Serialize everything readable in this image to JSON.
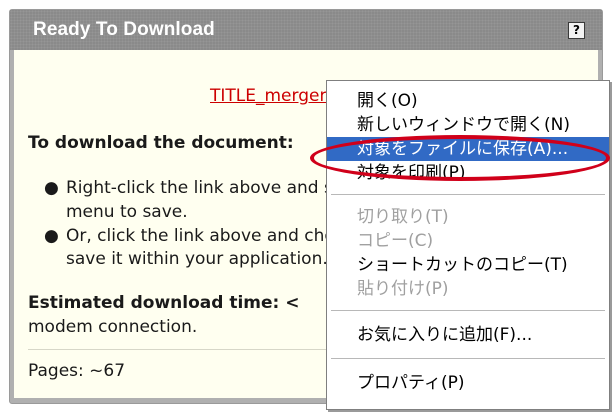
{
  "panel": {
    "title": "Ready To Download",
    "help_label": "?"
  },
  "content": {
    "doc_link": "TITLE_mergers.doc",
    "heading": "To download the document:",
    "bullets": [
      {
        "line1": "Right-click the link above and select the",
        "line2": "menu to save."
      },
      {
        "line1": "Or, click the link above and choose to",
        "line2": "save it within your application."
      }
    ],
    "estimate_label": "Estimated download time: <",
    "estimate_rest": "modem connection.",
    "pages": "Pages: ~67"
  },
  "context_menu": {
    "items": [
      {
        "label": "開く(O)",
        "state": "normal"
      },
      {
        "label": "新しいウィンドウで開く(N)",
        "state": "normal"
      },
      {
        "label": "対象をファイルに保存(A)...",
        "state": "selected"
      },
      {
        "label": "対象を印刷(P)",
        "state": "normal"
      },
      {
        "label": "切り取り(T)",
        "state": "disabled"
      },
      {
        "label": "コピー(C)",
        "state": "disabled"
      },
      {
        "label": "ショートカットのコピー(T)",
        "state": "normal"
      },
      {
        "label": "貼り付け(P)",
        "state": "disabled"
      },
      {
        "label": "お気に入りに追加(F)...",
        "state": "normal"
      },
      {
        "label": "プロパティ(P)",
        "state": "normal"
      }
    ],
    "selected_color": "#316ac5"
  },
  "annotation": {
    "highlight_color": "#d0001a"
  }
}
